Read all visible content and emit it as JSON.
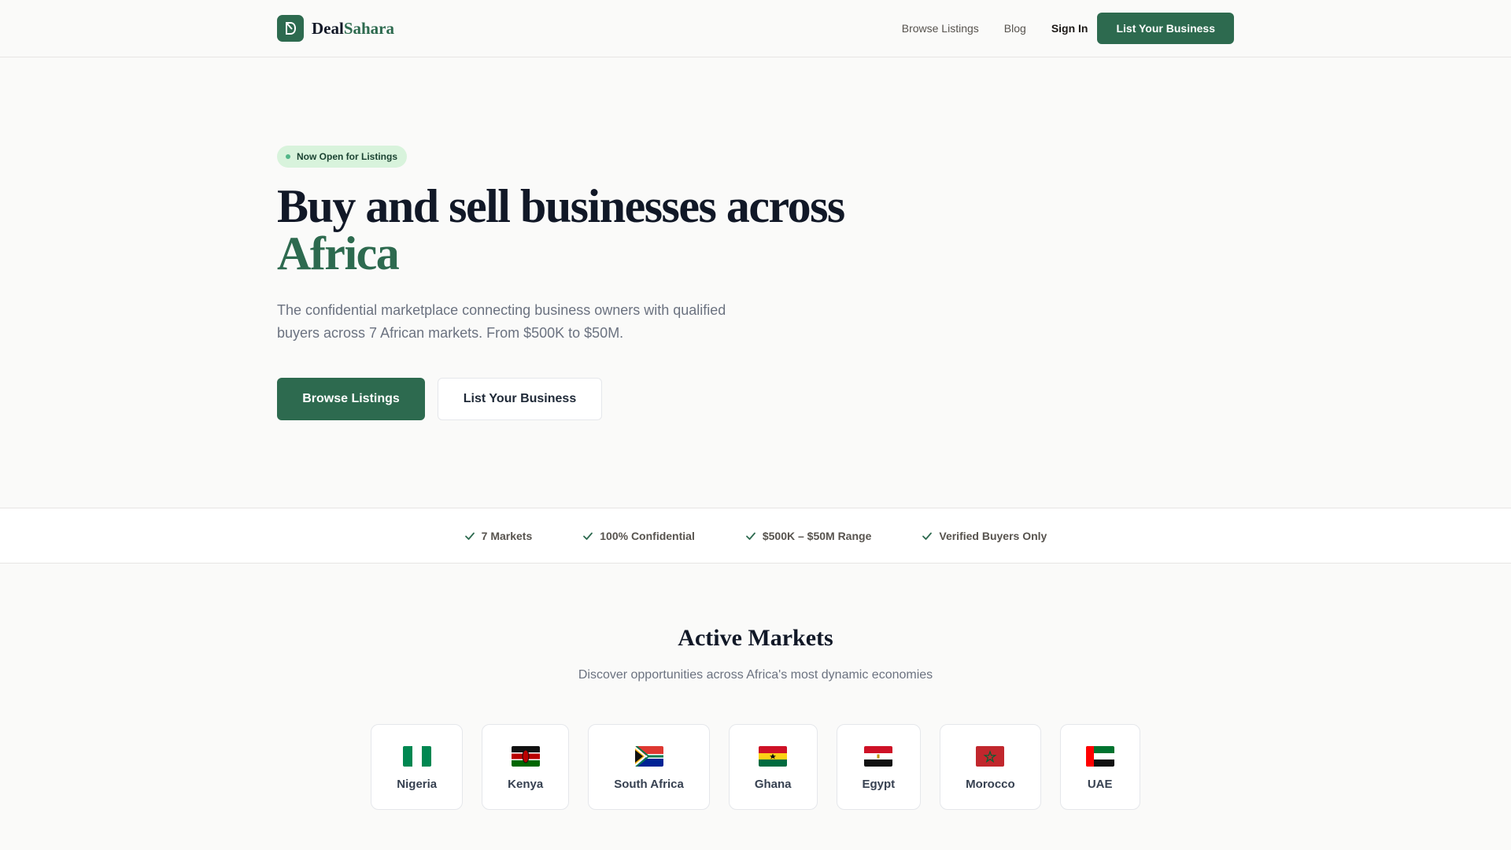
{
  "header": {
    "brand_part1": "Deal",
    "brand_part2": "Sahara",
    "nav": {
      "browse": "Browse Listings",
      "blog": "Blog",
      "signin": "Sign In",
      "cta": "List Your Business"
    }
  },
  "hero": {
    "badge": "Now Open for Listings",
    "title_line1": "Buy and sell businesses across",
    "title_line2": "Africa",
    "subtitle": "The confidential marketplace connecting business owners with qualified buyers across 7 African markets. From $500K to $50M.",
    "primary_button": "Browse Listings",
    "secondary_button": "List Your Business"
  },
  "trust": [
    {
      "label": "7 Markets"
    },
    {
      "label": "100% Confidential"
    },
    {
      "label": "$500K – $50M Range"
    },
    {
      "label": "Verified Buyers Only"
    }
  ],
  "markets": {
    "title": "Active Markets",
    "subtitle": "Discover opportunities across Africa's most dynamic economies",
    "items": [
      {
        "name": "Nigeria",
        "flag": "nigeria-flag-icon"
      },
      {
        "name": "Kenya",
        "flag": "kenya-flag-icon"
      },
      {
        "name": "South Africa",
        "flag": "south-africa-flag-icon"
      },
      {
        "name": "Ghana",
        "flag": "ghana-flag-icon"
      },
      {
        "name": "Egypt",
        "flag": "egypt-flag-icon"
      },
      {
        "name": "Morocco",
        "flag": "morocco-flag-icon"
      },
      {
        "name": "UAE",
        "flag": "uae-flag-icon"
      }
    ]
  },
  "colors": {
    "brand_green": "#2d6a4f",
    "badge_bg": "#d8f3dc",
    "page_bg": "#fafaf9"
  }
}
